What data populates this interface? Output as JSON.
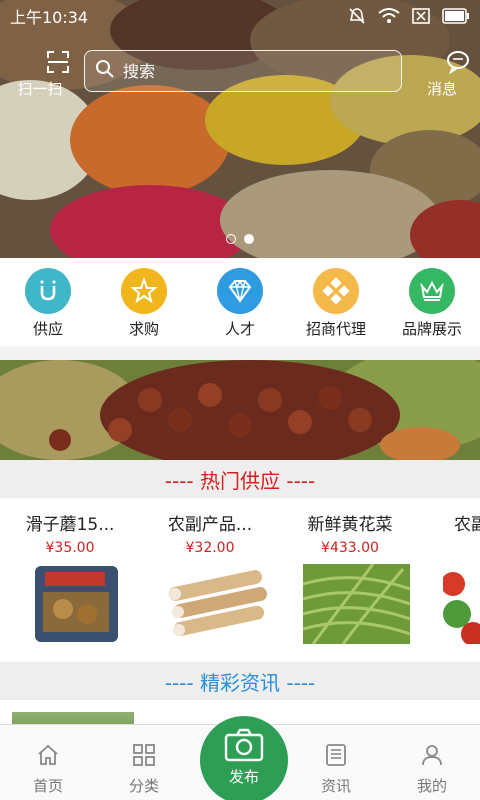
{
  "status_bar": {
    "time": "上午10:34"
  },
  "header": {
    "scan_label": "扫一扫",
    "search_placeholder": "搜索",
    "message_label": "消息"
  },
  "categories": [
    {
      "label": "供应",
      "color": "#3fb7c9",
      "icon": "u-icon"
    },
    {
      "label": "求购",
      "color": "#f0b61c",
      "icon": "star-icon"
    },
    {
      "label": "人才",
      "color": "#2f9be0",
      "icon": "diamond-icon"
    },
    {
      "label": "招商代理",
      "color": "#f5b94a",
      "icon": "puzzle-icon"
    },
    {
      "label": "品牌展示",
      "color": "#35b863",
      "icon": "crown-icon"
    }
  ],
  "sections": {
    "hot_supply": "---- 热门供应 ----",
    "news": "---- 精彩资讯 ----"
  },
  "products": [
    {
      "name": "滑子蘑15...",
      "price": "¥35.00"
    },
    {
      "name": "农副产品...",
      "price": "¥32.00"
    },
    {
      "name": "新鲜黄花菜",
      "price": "¥433.00"
    },
    {
      "name": "农副",
      "price": ""
    }
  ],
  "bottom_nav": {
    "home": "首页",
    "category": "分类",
    "publish": "发布",
    "news": "资讯",
    "mine": "我的"
  }
}
